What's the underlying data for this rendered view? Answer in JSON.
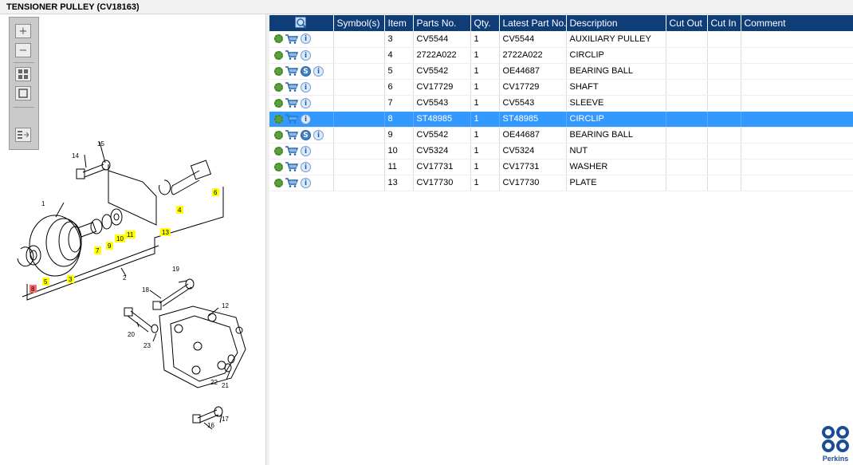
{
  "title": "TENSIONER PULLEY (CV18163)",
  "toolbar": {
    "zoom_in_icon": "plus-icon",
    "zoom_out_icon": "minus-icon",
    "fit_icon": "fit-all-icon",
    "select_icon": "square-icon",
    "list_icon": "list-arrow-icon"
  },
  "table": {
    "columns": [
      "",
      "Symbol(s)",
      "Item",
      "Parts No.",
      "Qty.",
      "Latest Part No.",
      "Description",
      "Cut Out",
      "Cut In",
      "Comment"
    ],
    "selected_index": 5,
    "rows": [
      {
        "item": "3",
        "part": "CV5544",
        "qty": "1",
        "latest": "CV5544",
        "desc": "AUXILIARY PULLEY",
        "s": false
      },
      {
        "item": "4",
        "part": "2722A022",
        "qty": "1",
        "latest": "2722A022",
        "desc": "CIRCLIP",
        "s": false
      },
      {
        "item": "5",
        "part": "CV5542",
        "qty": "1",
        "latest": "OE44687",
        "desc": "BEARING BALL",
        "s": true
      },
      {
        "item": "6",
        "part": "CV17729",
        "qty": "1",
        "latest": "CV17729",
        "desc": "SHAFT",
        "s": false
      },
      {
        "item": "7",
        "part": "CV5543",
        "qty": "1",
        "latest": "CV5543",
        "desc": "SLEEVE",
        "s": false
      },
      {
        "item": "8",
        "part": "ST48985",
        "qty": "1",
        "latest": "ST48985",
        "desc": "CIRCLIP",
        "s": false
      },
      {
        "item": "9",
        "part": "CV5542",
        "qty": "1",
        "latest": "OE44687",
        "desc": "BEARING BALL",
        "s": true
      },
      {
        "item": "10",
        "part": "CV5324",
        "qty": "1",
        "latest": "CV5324",
        "desc": "NUT",
        "s": false
      },
      {
        "item": "11",
        "part": "CV17731",
        "qty": "1",
        "latest": "CV17731",
        "desc": "WASHER",
        "s": false
      },
      {
        "item": "13",
        "part": "CV17730",
        "qty": "1",
        "latest": "CV17730",
        "desc": "PLATE",
        "s": false
      }
    ]
  },
  "diagram_labels": {
    "l1": "1",
    "l2": "2",
    "l3": "3",
    "l4": "4",
    "l5": "5",
    "l6": "6",
    "l7": "7",
    "l8": "8",
    "l9": "9",
    "l10": "10",
    "l11": "11",
    "l12": "12",
    "l13": "13",
    "l14": "14",
    "l15": "15",
    "l16": "16",
    "l17": "17",
    "l18": "18",
    "l19": "19",
    "l20": "20",
    "l21": "21",
    "l22": "22",
    "l23": "23"
  },
  "logo": {
    "text": "Perkins",
    "color": "#1a4e94"
  },
  "colors": {
    "header": "#0f3d78",
    "selected_row": "#3399ff",
    "callout_highlight": "#ffff00",
    "selected_callout": "#ff6b6b"
  }
}
